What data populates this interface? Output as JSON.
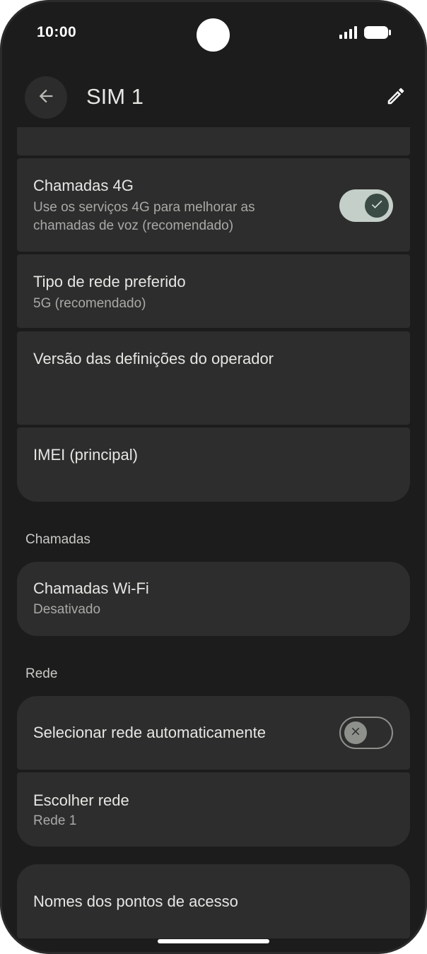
{
  "status_bar": {
    "time": "10:00",
    "icons": [
      "signal-icon",
      "battery-icon"
    ]
  },
  "header": {
    "title": "SIM 1",
    "back_icon": "arrow-left-icon",
    "edit_icon": "pencil-icon"
  },
  "items": {
    "calls_4g": {
      "title": "Chamadas 4G",
      "subtitle_line1": "Use os serviços 4G para melhorar as",
      "subtitle_line2": "chamadas de voz (recomendado)",
      "toggle_on": true
    },
    "network_type": {
      "title": "Tipo de rede preferido",
      "subtitle": "5G (recomendado)"
    },
    "carrier_settings": {
      "title": "Versão das definições do operador"
    },
    "imei": {
      "title": "IMEI (principal)"
    }
  },
  "sections": {
    "calls": {
      "label": "Chamadas",
      "wifi_calling": {
        "title": "Chamadas Wi-Fi",
        "subtitle": "Desativado"
      }
    },
    "network": {
      "label": "Rede",
      "auto_select": {
        "title": "Selecionar rede automaticamente",
        "toggle_on": false
      },
      "choose_network": {
        "title": "Escolher rede",
        "subtitle": "Rede 1"
      }
    },
    "apn": {
      "title": "Nomes dos pontos de acesso"
    }
  },
  "colors": {
    "background": "#1b1c1b",
    "card": "#2c2d2c",
    "text_primary": "#e6e6e3",
    "text_secondary": "#a9aaa6",
    "toggle_on_track": "#c4cfc9",
    "toggle_on_knob": "#3a4a45"
  }
}
